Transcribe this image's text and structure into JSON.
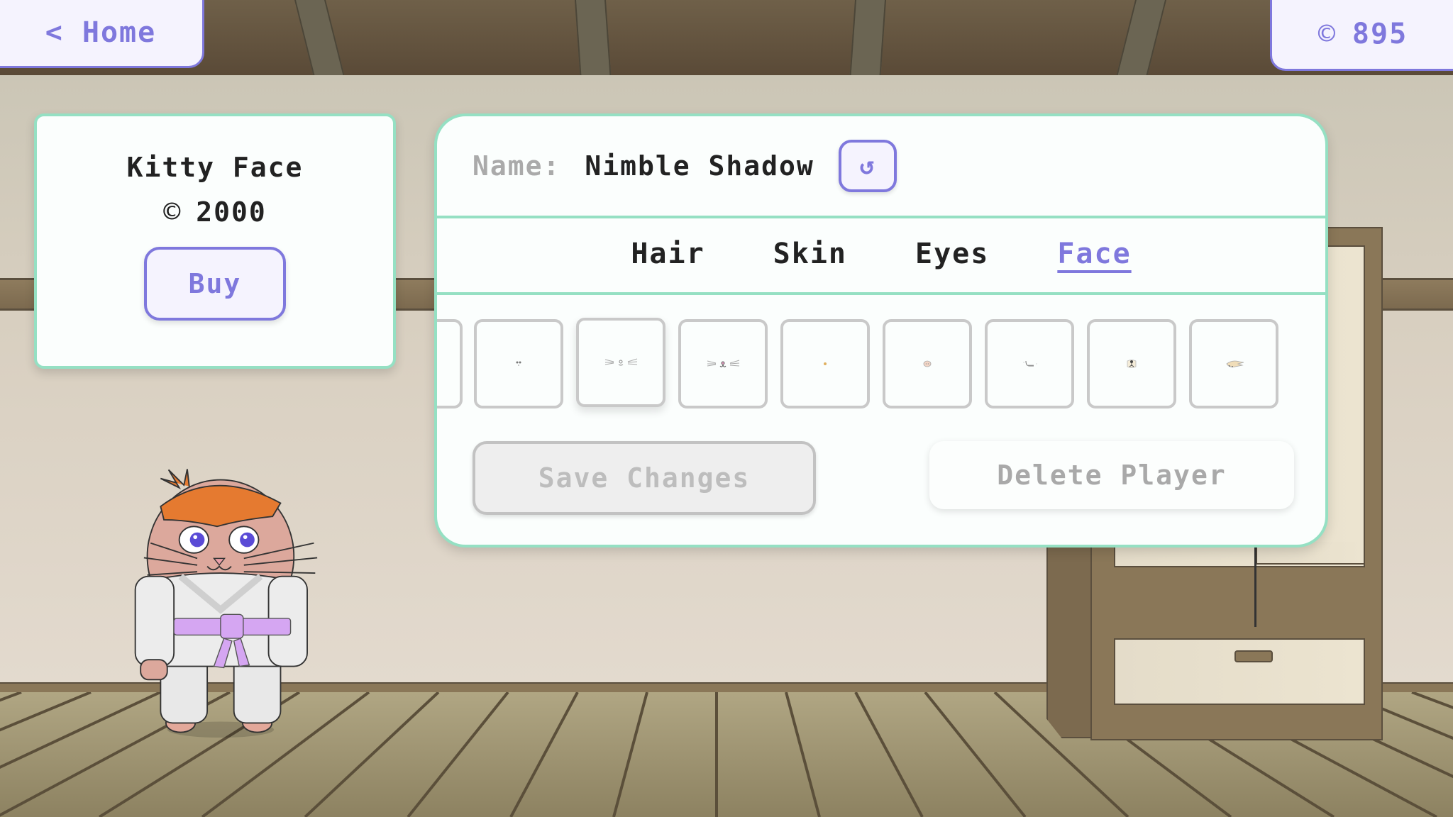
{
  "topbar": {
    "home_label": "Home",
    "home_icon": "chevron-left-icon",
    "coin_icon": "©",
    "coin_balance": "895"
  },
  "item_card": {
    "name": "Kitty Face",
    "price_icon": "©",
    "price": "2000",
    "buy_label": "Buy"
  },
  "editor": {
    "name_label": "Name:",
    "name_value": "Nimble Shadow",
    "reroll_icon": "↺",
    "tabs": [
      {
        "label": "Hair",
        "active": false
      },
      {
        "label": "Skin",
        "active": false
      },
      {
        "label": "Eyes",
        "active": false
      },
      {
        "label": "Face",
        "active": true
      }
    ],
    "face_items": [
      {
        "name": "partial-previous",
        "selected": false
      },
      {
        "name": "tiny-nose",
        "selected": false
      },
      {
        "name": "kitty-whiskers",
        "selected": true
      },
      {
        "name": "kitty-whiskers-smile",
        "selected": false
      },
      {
        "name": "dot-nose",
        "selected": false
      },
      {
        "name": "pig-snout",
        "selected": false
      },
      {
        "name": "mustache",
        "selected": false
      },
      {
        "name": "dog-nose",
        "selected": false
      },
      {
        "name": "beard",
        "selected": false
      }
    ],
    "save_label": "Save Changes",
    "delete_label": "Delete Player"
  },
  "colors": {
    "accent": "#7f78dd",
    "panel_border": "#95e0c3",
    "disabled_text": "#bdbdbd"
  }
}
